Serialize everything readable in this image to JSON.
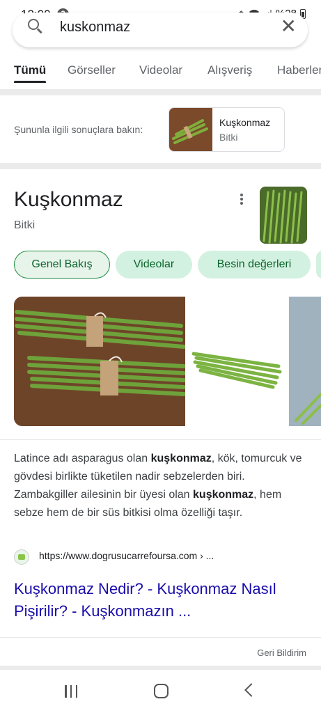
{
  "status_bar": {
    "time": "12:00",
    "notification_count": "3",
    "battery": "%28"
  },
  "search": {
    "query": "kuskonmaz"
  },
  "tabs": [
    {
      "label": "Tümü",
      "active": true
    },
    {
      "label": "Görseller"
    },
    {
      "label": "Videolar"
    },
    {
      "label": "Alışveriş"
    },
    {
      "label": "Haberler"
    }
  ],
  "related": {
    "label": "Şununla ilgili sonuçlara bakın:",
    "chip": {
      "title": "Kuşkonmaz",
      "subtitle": "Bitki"
    }
  },
  "knowledge_panel": {
    "title": "Kuşkonmaz",
    "subtitle": "Bitki",
    "chips": [
      {
        "label": "Genel Bakış",
        "active": true
      },
      {
        "label": "Videolar"
      },
      {
        "label": "Besin değerleri"
      }
    ],
    "description": {
      "p1": "Latince adı asparagus olan ",
      "b1": "kuşkonmaz",
      "p2": ", kök, tomurcuk ve gövdesi birlikte tüketilen nadir sebzelerden biri. Zambakgiller ailesinin bir üyesi olan ",
      "b2": "kuşkonmaz",
      "p3": ", hem sebze hem de bir süs bitkisi olma özelliği taşır."
    },
    "source_url": "https://www.dogrusucarrefoursa.com › ...",
    "link_title": "Kuşkonmaz Nedir? - Kuşkonmaz Nasıl Pişirilir? - Kuşkonmazın ...",
    "feedback": "Geri Bildirim"
  },
  "colors": {
    "accent_green": "#1e8e3e",
    "chip_bg": "#d2f1e0",
    "link": "#1a0dab"
  },
  "icons": [
    "search-icon",
    "clear-icon",
    "more-options-icon",
    "site-favicon",
    "recents-icon",
    "home-icon",
    "back-icon"
  ]
}
